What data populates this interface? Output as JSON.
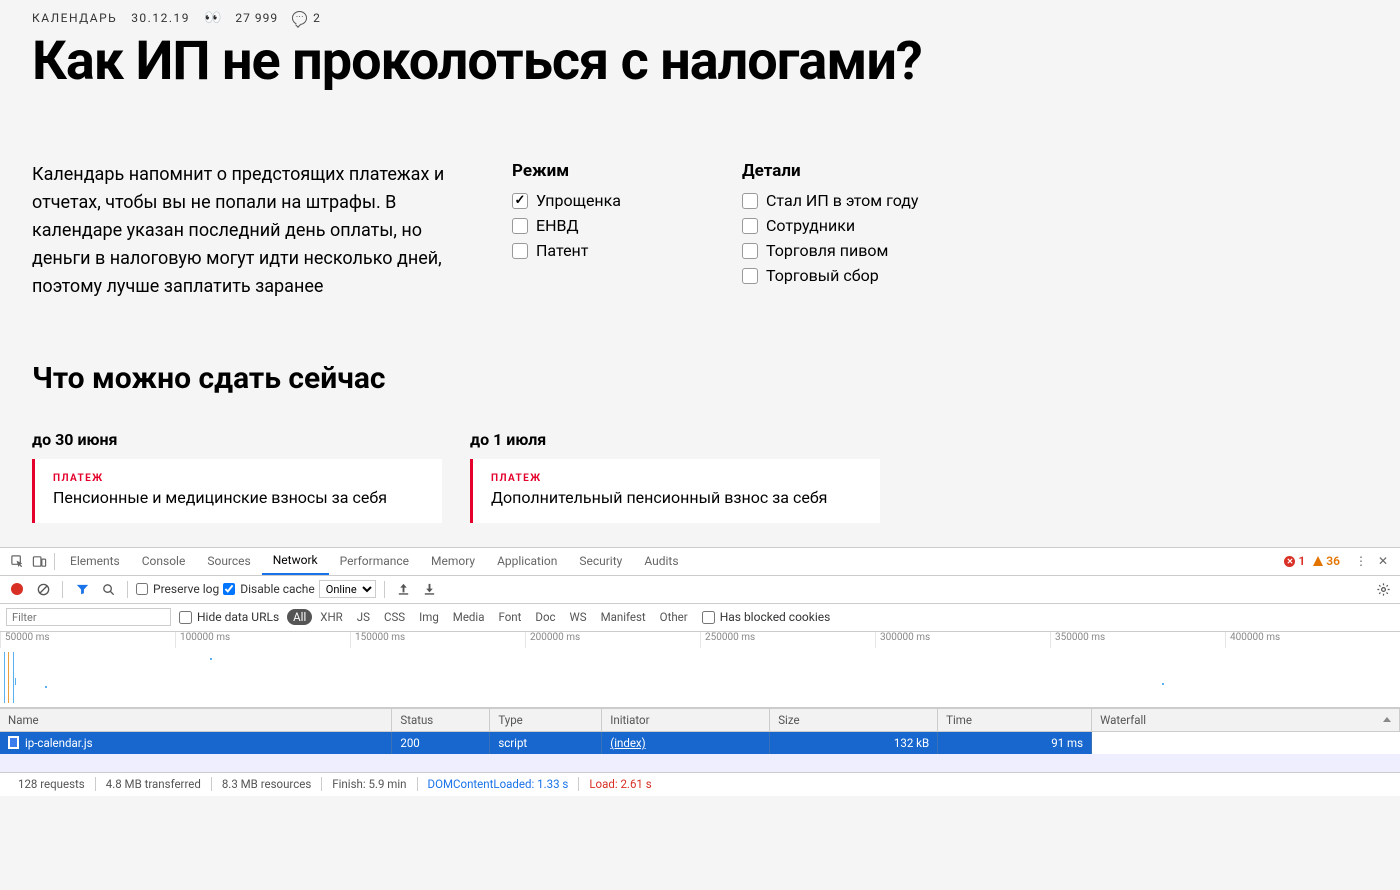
{
  "article": {
    "category": "КАЛЕНДАРЬ",
    "date": "30.12.19",
    "views": "27 999",
    "comments": "2",
    "title": "Как ИП не проколоться с налогами?",
    "intro": "Календарь напомнит о предстоящих платежах и отчетах, чтобы вы не попали на штрафы. В календаре указан последний день оплаты, но деньги в налоговую могут идти несколько дней, поэтому лучше заплатить заранее",
    "mode_heading": "Режим",
    "modes": [
      {
        "label": "Упрощенка",
        "checked": true
      },
      {
        "label": "ЕНВД",
        "checked": false
      },
      {
        "label": "Патент",
        "checked": false
      }
    ],
    "details_heading": "Детали",
    "details": [
      {
        "label": "Стал ИП в этом году",
        "checked": false
      },
      {
        "label": "Сотрудники",
        "checked": false
      },
      {
        "label": "Торговля пивом",
        "checked": false
      },
      {
        "label": "Торговый сбор",
        "checked": false
      }
    ],
    "section_heading": "Что можно сдать сейчас",
    "cards": [
      {
        "due": "до 30 июня",
        "tag": "ПЛАТЕЖ",
        "title": "Пенсионные и медицинские взносы за себя"
      },
      {
        "due": "до 1 июля",
        "tag": "ПЛАТЕЖ",
        "title": "Дополнительный пенсионный взнос за себя"
      }
    ]
  },
  "devtools": {
    "tabs": [
      "Elements",
      "Console",
      "Sources",
      "Network",
      "Performance",
      "Memory",
      "Application",
      "Security",
      "Audits"
    ],
    "active_tab": "Network",
    "error_count": "1",
    "warning_count": "36",
    "preserve_log_label": "Preserve log",
    "disable_cache_label": "Disable cache",
    "disable_cache_checked": true,
    "throttle": "Online",
    "filter_placeholder": "Filter",
    "hide_data_urls_label": "Hide data URLs",
    "type_filters": [
      "All",
      "XHR",
      "JS",
      "CSS",
      "Img",
      "Media",
      "Font",
      "Doc",
      "WS",
      "Manifest",
      "Other"
    ],
    "active_type_filter": "All",
    "blocked_cookies_label": "Has blocked cookies",
    "timeline_ticks": [
      "50000 ms",
      "100000 ms",
      "150000 ms",
      "200000 ms",
      "250000 ms",
      "300000 ms",
      "350000 ms",
      "400000 ms"
    ],
    "columns": [
      "Name",
      "Status",
      "Type",
      "Initiator",
      "Size",
      "Time",
      "Waterfall"
    ],
    "row": {
      "name": "ip-calendar.js",
      "status": "200",
      "type": "script",
      "initiator": "(index)",
      "size": "132 kB",
      "time": "91 ms"
    },
    "footer": {
      "requests": "128 requests",
      "transferred": "4.8 MB transferred",
      "resources": "8.3 MB resources",
      "finish": "Finish: 5.9 min",
      "dcl": "DOMContentLoaded: 1.33 s",
      "load": "Load: 2.61 s"
    }
  }
}
